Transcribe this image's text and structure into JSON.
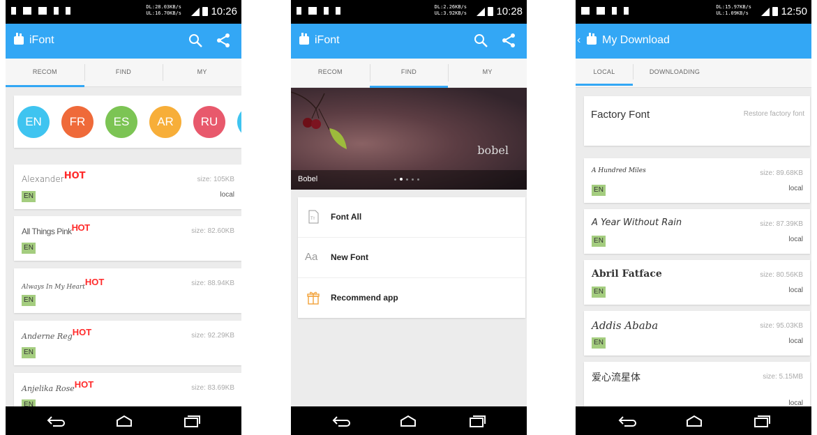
{
  "screens": [
    {
      "status": {
        "speed_dl": "DL:28.03KB/s",
        "speed_ul": "UL:16.70KB/s",
        "time": "10:26"
      },
      "app": {
        "title": "iFont"
      },
      "tabs": [
        "RECOM",
        "FIND",
        "MY"
      ],
      "languages": [
        {
          "code": "EN",
          "color": "#3fc4f0"
        },
        {
          "code": "FR",
          "color": "#ef6a3a"
        },
        {
          "code": "ES",
          "color": "#7cc454"
        },
        {
          "code": "AR",
          "color": "#f7ae39"
        },
        {
          "code": "RU",
          "color": "#e8596c"
        }
      ],
      "fonts": [
        {
          "name": "Alexander",
          "hot": "HOT",
          "size": "size: 105KB",
          "lang": "EN",
          "status": "local"
        },
        {
          "name": "All Things Pink",
          "hot": "HOT",
          "size": "size: 82.60KB",
          "lang": "EN",
          "status": ""
        },
        {
          "name": "Always In My Heart",
          "hot": "HOT",
          "size": "size: 88.94KB",
          "lang": "EN",
          "status": ""
        },
        {
          "name": "Anderne Reg",
          "hot": "HOT",
          "size": "size: 92.29KB",
          "lang": "EN",
          "status": ""
        },
        {
          "name": "Anjelika Rose",
          "hot": "HOT",
          "size": "size: 83.69KB",
          "lang": "EN",
          "status": ""
        }
      ]
    },
    {
      "status": {
        "speed_dl": "DL:2.26KB/s",
        "speed_ul": "UL:3.92KB/s",
        "time": "10:28"
      },
      "app": {
        "title": "iFont"
      },
      "tabs": [
        "RECOM",
        "FIND",
        "MY"
      ],
      "banner": {
        "watermark": "bobel",
        "caption": "Bobel"
      },
      "menu": [
        {
          "icon": "font-file-icon",
          "label": "Font All"
        },
        {
          "icon": "aa-text-icon",
          "label": "New Font",
          "glyph": "Aa"
        },
        {
          "icon": "gift-icon",
          "label": "Recommend app"
        }
      ]
    },
    {
      "status": {
        "speed_dl": "DL:15.97KB/s",
        "speed_ul": "UL:1.09KB/s",
        "time": "12:50"
      },
      "app": {
        "title": "My Download"
      },
      "tabs": [
        "LOCAL",
        "DOWNLOADING"
      ],
      "factory": {
        "name": "Factory Font",
        "action": "Restore factory font"
      },
      "fonts": [
        {
          "name": "A Hundred Miles",
          "size": "size: 89.68KB",
          "lang": "EN",
          "status": "local"
        },
        {
          "name": "A Year Without Rain",
          "size": "size: 87.39KB",
          "lang": "EN",
          "status": "local"
        },
        {
          "name": "Abril Fatface",
          "size": "size: 80.56KB",
          "lang": "EN",
          "status": "local"
        },
        {
          "name": "Addis Ababa",
          "size": "size: 95.03KB",
          "lang": "EN",
          "status": "local"
        },
        {
          "name": "爱心流星体",
          "size": "size: 5.15MB",
          "lang": "",
          "status": "local"
        }
      ]
    }
  ]
}
